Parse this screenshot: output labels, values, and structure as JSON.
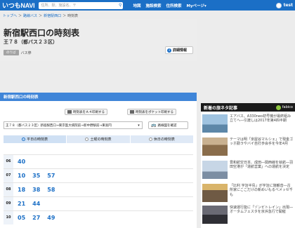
{
  "topbar": {
    "logo": "いつもNAVI",
    "search_placeholder": "住所、駅、施設名、〒",
    "nav": [
      "地図",
      "施設検索",
      "住所検索",
      "Myページ"
    ],
    "nav_suffix": "▾",
    "user": "test"
  },
  "breadcrumb": [
    "トップへ",
    "路線バス",
    "新宿駅西口",
    "時刻表"
  ],
  "header": {
    "title": "新宿駅西口の時刻表",
    "route": "王７８（都バス２３区）",
    "badge": "のりば",
    "bus_label": "バス停",
    "info_button": "詳細情報"
  },
  "main": {
    "header": "新宿駅西口の時刻表",
    "print_a4": "時刻表をＡ４印刷する",
    "print_pocket": "時刻表をポケット印刷する",
    "route_select": "王７８（都バス２３区）新宿駅西口→東京医大病院前→新中野駅前→東高円",
    "confirm_button": "路線図を確認",
    "tabs": [
      "平日の時刻表",
      "土曜の時刻表",
      "休日の時刻表"
    ],
    "rows": [
      {
        "hour": "06",
        "minutes": [
          "40"
        ]
      },
      {
        "hour": "07",
        "minutes": [
          "10",
          "35",
          "57"
        ]
      },
      {
        "hour": "08",
        "minutes": [
          "18",
          "38",
          "58"
        ]
      },
      {
        "hour": "09",
        "minutes": [
          "21",
          "44"
        ]
      },
      {
        "hour": "10",
        "minutes": [
          "05",
          "27",
          "49"
        ]
      }
    ]
  },
  "news": {
    "title": "新着の旅ネタ記事",
    "brand": "fabico",
    "items": [
      {
        "text": "エアバス、A330neo初号機が最終組み立てへ―引渡しは2017年第4四半期"
      },
      {
        "text": "テーマは明「京屋谷マルシェ」で現金ゴッホ勤ラやバイ自打歩会手を今年4月"
      },
      {
        "text": "豊和航空日本、成田―関西線を就航―羽田空港が「運航営業」への運航を決定"
      },
      {
        "text": "「比利 宇治半島」が宇治に施観音―古所家にここだけの新めいもるべメッセ千も"
      },
      {
        "text": "快速運行能に「ゾンビトレイン」出現―オータムフェスタを京浜急行で開催"
      }
    ],
    "thumb_colors": [
      "#5d87a8",
      "#8a6d4b",
      "#7c8ea3",
      "#6f5a44",
      "#2f2f35"
    ]
  },
  "colors": {
    "brand": "#1b6fc6",
    "accent_bar": "#3f85d8",
    "news_header": "#1a1a1a",
    "minute_text": "#1b6fc6"
  }
}
